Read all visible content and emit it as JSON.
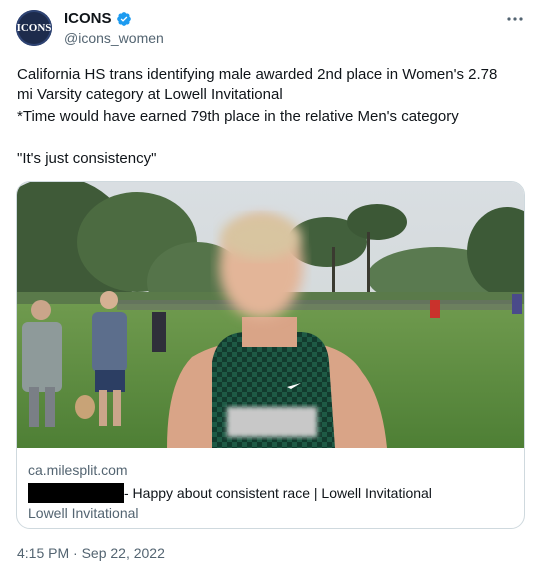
{
  "author": {
    "avatar_text": "ICONS",
    "display_name": "ICONS",
    "handle": "@icons_women"
  },
  "tweet": {
    "lines": [
      "California HS trans identifying male awarded 2nd place in Women's 2.78",
      "mi Varsity category at Lowell Invitational",
      "*Time would have earned 79th place in the relative Men's category",
      "\"It's just consistency\""
    ],
    "timestamp": "4:15 PM · Sep 22, 2022"
  },
  "card": {
    "domain": "ca.milesplit.com",
    "title": "- Happy about consistent race | Lowell Invitational",
    "description": "Lowell Invitational"
  },
  "colors": {
    "verified": "#1d9bf0",
    "secondary_text": "#536471",
    "border": "#cfd9de"
  },
  "icons": {
    "verified": "verified-badge-icon",
    "more": "more-options-icon"
  }
}
